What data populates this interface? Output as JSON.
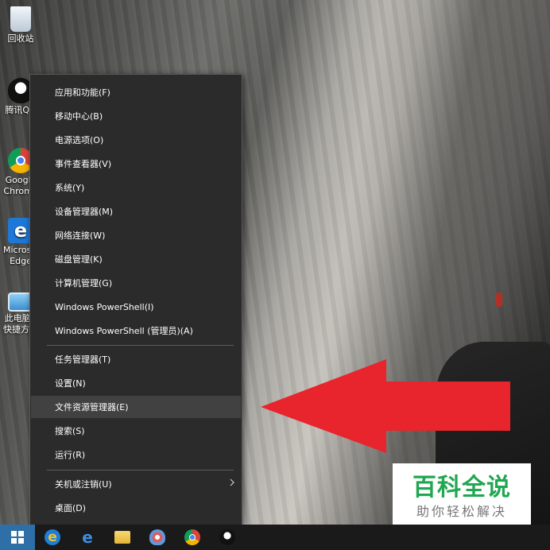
{
  "desktop": {
    "icons": [
      {
        "label": "回收站"
      },
      {
        "label": "腾讯QQ"
      },
      {
        "label": "Google Chrome"
      },
      {
        "label": "Microsoft Edge"
      },
      {
        "label": "此电脑 - 快捷方式"
      }
    ]
  },
  "context_menu": {
    "items": [
      {
        "label": "应用和功能(F)"
      },
      {
        "label": "移动中心(B)"
      },
      {
        "label": "电源选项(O)"
      },
      {
        "label": "事件查看器(V)"
      },
      {
        "label": "系统(Y)"
      },
      {
        "label": "设备管理器(M)"
      },
      {
        "label": "网络连接(W)"
      },
      {
        "label": "磁盘管理(K)"
      },
      {
        "label": "计算机管理(G)"
      },
      {
        "label": "Windows PowerShell(I)"
      },
      {
        "label": "Windows PowerShell (管理员)(A)"
      },
      {
        "label": "任务管理器(T)"
      },
      {
        "label": "设置(N)"
      },
      {
        "label": "文件资源管理器(E)"
      },
      {
        "label": "搜索(S)"
      },
      {
        "label": "运行(R)"
      },
      {
        "label": "关机或注销(U)"
      },
      {
        "label": "桌面(D)"
      }
    ],
    "highlighted_item": "文件资源管理器(E)"
  },
  "annotation": {
    "arrow_color": "#e8242c"
  },
  "watermark": {
    "title": "百科全说",
    "subtitle": "助你轻松解决",
    "title_color": "#1fa84f"
  },
  "taskbar": {
    "items": [
      "start-icon",
      "ie-icon",
      "edge-icon",
      "file-explorer-icon",
      "paint-icon",
      "chrome-icon",
      "qq-icon"
    ],
    "start_color": "#2e6fa8"
  }
}
